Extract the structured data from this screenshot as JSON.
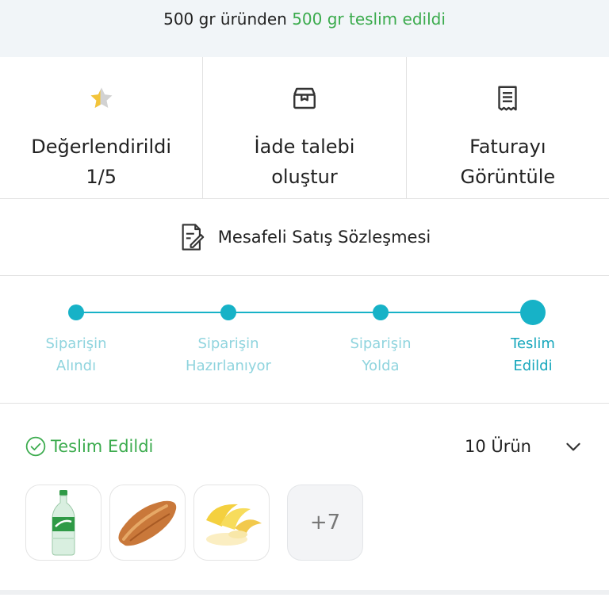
{
  "banner": {
    "prefix": "500 gr üründen",
    "highlight": "500 gr teslim edildi"
  },
  "actions": [
    {
      "icon": "star-icon",
      "line1": "Değerlendirildi",
      "line2": "1/5"
    },
    {
      "icon": "return-box-icon",
      "line1": "İade talebi",
      "line2": "oluştur"
    },
    {
      "icon": "invoice-icon",
      "line1": "Faturayı",
      "line2": "Görüntüle"
    }
  ],
  "contract": {
    "label": "Mesafeli Satış Sözleşmesi",
    "icon": "document-edit-icon"
  },
  "timeline": {
    "steps": [
      {
        "line1": "Siparişin",
        "line2": "Alındı"
      },
      {
        "line1": "Siparişin",
        "line2": "Hazırlanıyor"
      },
      {
        "line1": "Siparişin",
        "line2": "Yolda"
      },
      {
        "line1": "Teslim",
        "line2": "Edildi"
      }
    ],
    "active_step": 4
  },
  "status": {
    "label": "Teslim Edildi",
    "count_label": "10 Ürün"
  },
  "products": {
    "items": [
      {
        "name": "sprite-bottle",
        "icon": "bottle-icon"
      },
      {
        "name": "bread",
        "icon": "bread-icon"
      },
      {
        "name": "banana",
        "icon": "banana-icon"
      }
    ],
    "more_label": "+7"
  },
  "colors": {
    "accent": "#17b2c7",
    "success": "#3bab4d",
    "banner_bg": "#f1f5f8"
  }
}
